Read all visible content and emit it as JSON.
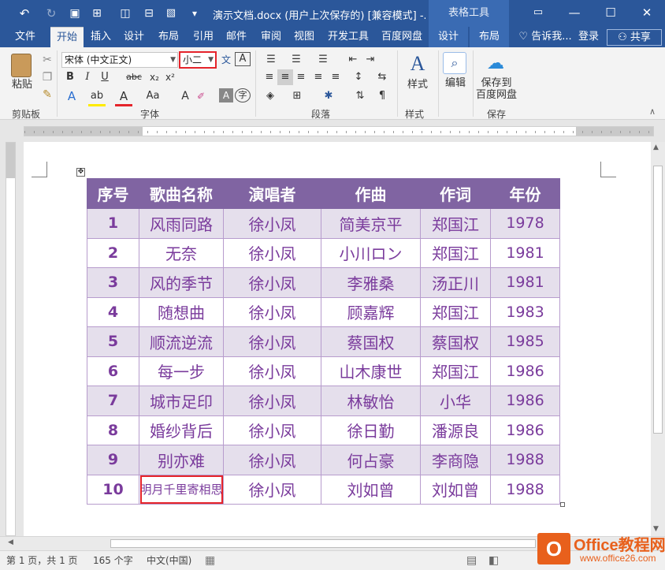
{
  "titlebar": {
    "doc_title": "演示文档.docx (用户上次保存的) [兼容模式] -...",
    "context_group": "表格工具",
    "undo": "↶",
    "redo": "↻",
    "save": "💾",
    "more": "▾"
  },
  "tabs": [
    "文件",
    "开始",
    "插入",
    "设计",
    "布局",
    "引用",
    "邮件",
    "审阅",
    "视图",
    "开发工具",
    "百度网盘",
    "设计",
    "布局"
  ],
  "active_tab": "开始",
  "tell_me": "告诉我...",
  "login": "登录",
  "share": "共享",
  "ribbon": {
    "paste": "粘贴",
    "font_name": "宋体 (中文正文)",
    "font_size": "小二",
    "style": "样式",
    "edit": "编辑",
    "save_baidu_1": "保存到",
    "save_baidu_2": "百度网盘",
    "groups": {
      "clipboard": "剪贴板",
      "font": "字体",
      "paragraph": "段落",
      "styles": "样式",
      "save": "保存"
    },
    "bold": "B",
    "italic": "I",
    "underline": "U",
    "strike": "abc",
    "sub": "x₂",
    "sup": "x²",
    "font_color_a": "A",
    "aa": "Aa"
  },
  "table": {
    "headers": [
      "序号",
      "歌曲名称",
      "演唱者",
      "作曲",
      "作词",
      "年份"
    ],
    "rows": [
      [
        "1",
        "风雨同路",
        "徐小凤",
        "简美京平",
        "郑国江",
        "1978"
      ],
      [
        "2",
        "无奈",
        "徐小凤",
        "小川ロン",
        "郑国江",
        "1981"
      ],
      [
        "3",
        "风的季节",
        "徐小凤",
        "李雅桑",
        "汤正川",
        "1981"
      ],
      [
        "4",
        "随想曲",
        "徐小凤",
        "顾嘉辉",
        "郑国江",
        "1983"
      ],
      [
        "5",
        "顺流逆流",
        "徐小凤",
        "蔡国权",
        "蔡国权",
        "1985"
      ],
      [
        "6",
        "每一步",
        "徐小凤",
        "山木康世",
        "郑国江",
        "1986"
      ],
      [
        "7",
        "城市足印",
        "徐小凤",
        "林敏怡",
        "小华",
        "1986"
      ],
      [
        "8",
        "婚纱背后",
        "徐小凤",
        "徐日勤",
        "潘源良",
        "1986"
      ],
      [
        "9",
        "别亦难",
        "徐小凤",
        "何占豪",
        "李商隐",
        "1988"
      ],
      [
        "10",
        "明月千里寄相思",
        "徐小凤",
        "刘如曾",
        "刘如曾",
        "1988"
      ]
    ]
  },
  "status": {
    "page": "第 1 页，共 1 页",
    "words": "165 个字",
    "lang": "中文(中国)"
  },
  "watermark": {
    "logo": "O",
    "t1": "Office教程网",
    "t2": "www.office26.com"
  },
  "colors": {
    "title_blue": "#2b579a",
    "header_purple": "#8064a2",
    "band_lavender": "#e5dfec",
    "text_purple": "#7a3b9c",
    "highlight_red": "#e5242b"
  }
}
